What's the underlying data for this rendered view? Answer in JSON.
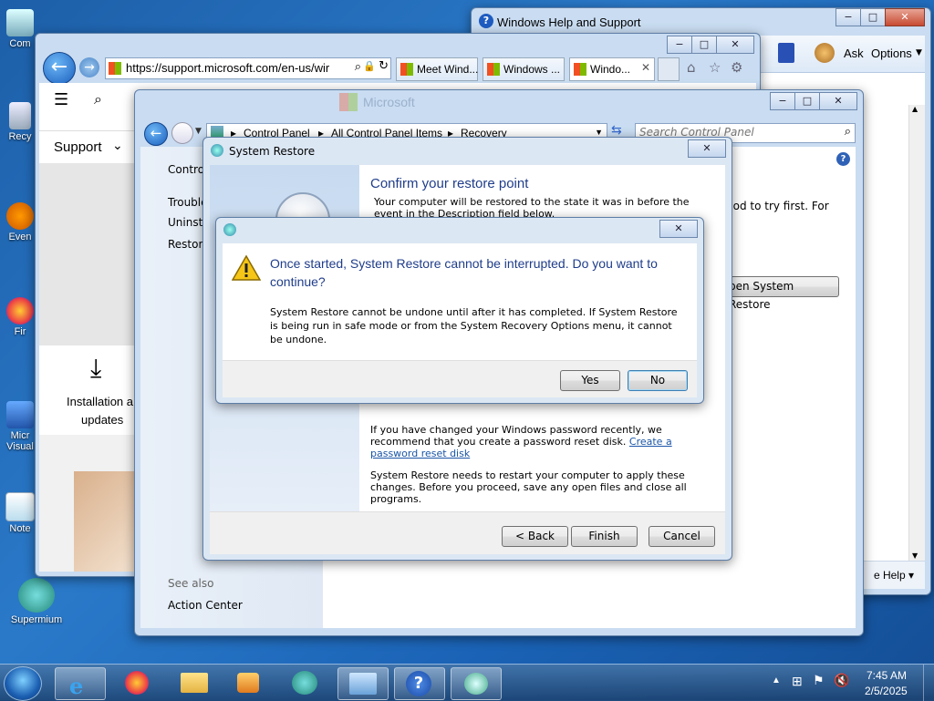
{
  "desktop": {
    "icons": [
      {
        "label": "Com"
      },
      {
        "label": "Recy"
      },
      {
        "label": "Even"
      },
      {
        "label": "Fir"
      },
      {
        "label": "Micr Visual"
      },
      {
        "label": "Note"
      },
      {
        "label": "Supermium"
      }
    ]
  },
  "help_window": {
    "title": "Windows Help and Support",
    "ask": "Ask",
    "options": "Options",
    "help_menu": "e Help",
    "min": "−",
    "max": "□",
    "close": "✕"
  },
  "browser": {
    "url": "https://support.microsoft.com/en-us/wir",
    "tabs": [
      {
        "label": "Meet Wind..."
      },
      {
        "label": "Windows ..."
      },
      {
        "label": "Windo..."
      }
    ],
    "support_label": "Support",
    "download_label_1": "Installation a",
    "download_label_2": "updates"
  },
  "control_panel": {
    "breadcrumb": [
      "Control Panel",
      "All Control Panel Items",
      "Recovery"
    ],
    "search_placeholder": "Search Control Panel",
    "left_links": [
      "Contro",
      "Trouble",
      "Uninsta",
      "Restore"
    ],
    "see_also": "See also",
    "action_center": "Action Center",
    "right_text": "hod to try first. For",
    "open_restore": "pen System Restore",
    "logo_text": "Microsoft"
  },
  "system_restore": {
    "title": "System Restore",
    "heading": "Confirm your restore point",
    "intro": "Your computer will be restored to the state it was in before the event in the Description field below.",
    "password_text": "If you have changed your Windows password recently, we recommend that you create a password reset disk.",
    "password_link": "Create a password reset disk",
    "restart_text": "System Restore needs to restart your computer to apply these changes. Before you proceed, save any open files and close all programs.",
    "back": "< Back",
    "finish": "Finish",
    "cancel": "Cancel"
  },
  "confirm_dialog": {
    "headline": "Once started, System Restore cannot be interrupted. Do you want to continue?",
    "body": "System Restore cannot be undone until after it has completed. If System Restore is being run in safe mode or from the System Recovery Options menu, it cannot be undone.",
    "yes": "Yes",
    "no": "No"
  },
  "taskbar": {
    "time": "7:45 AM",
    "date": "2/5/2025"
  },
  "colors": {
    "accent_link": "#1a55a8",
    "dialog_heading": "#1f3d8a",
    "desktop_bg": "#2a79c9"
  }
}
